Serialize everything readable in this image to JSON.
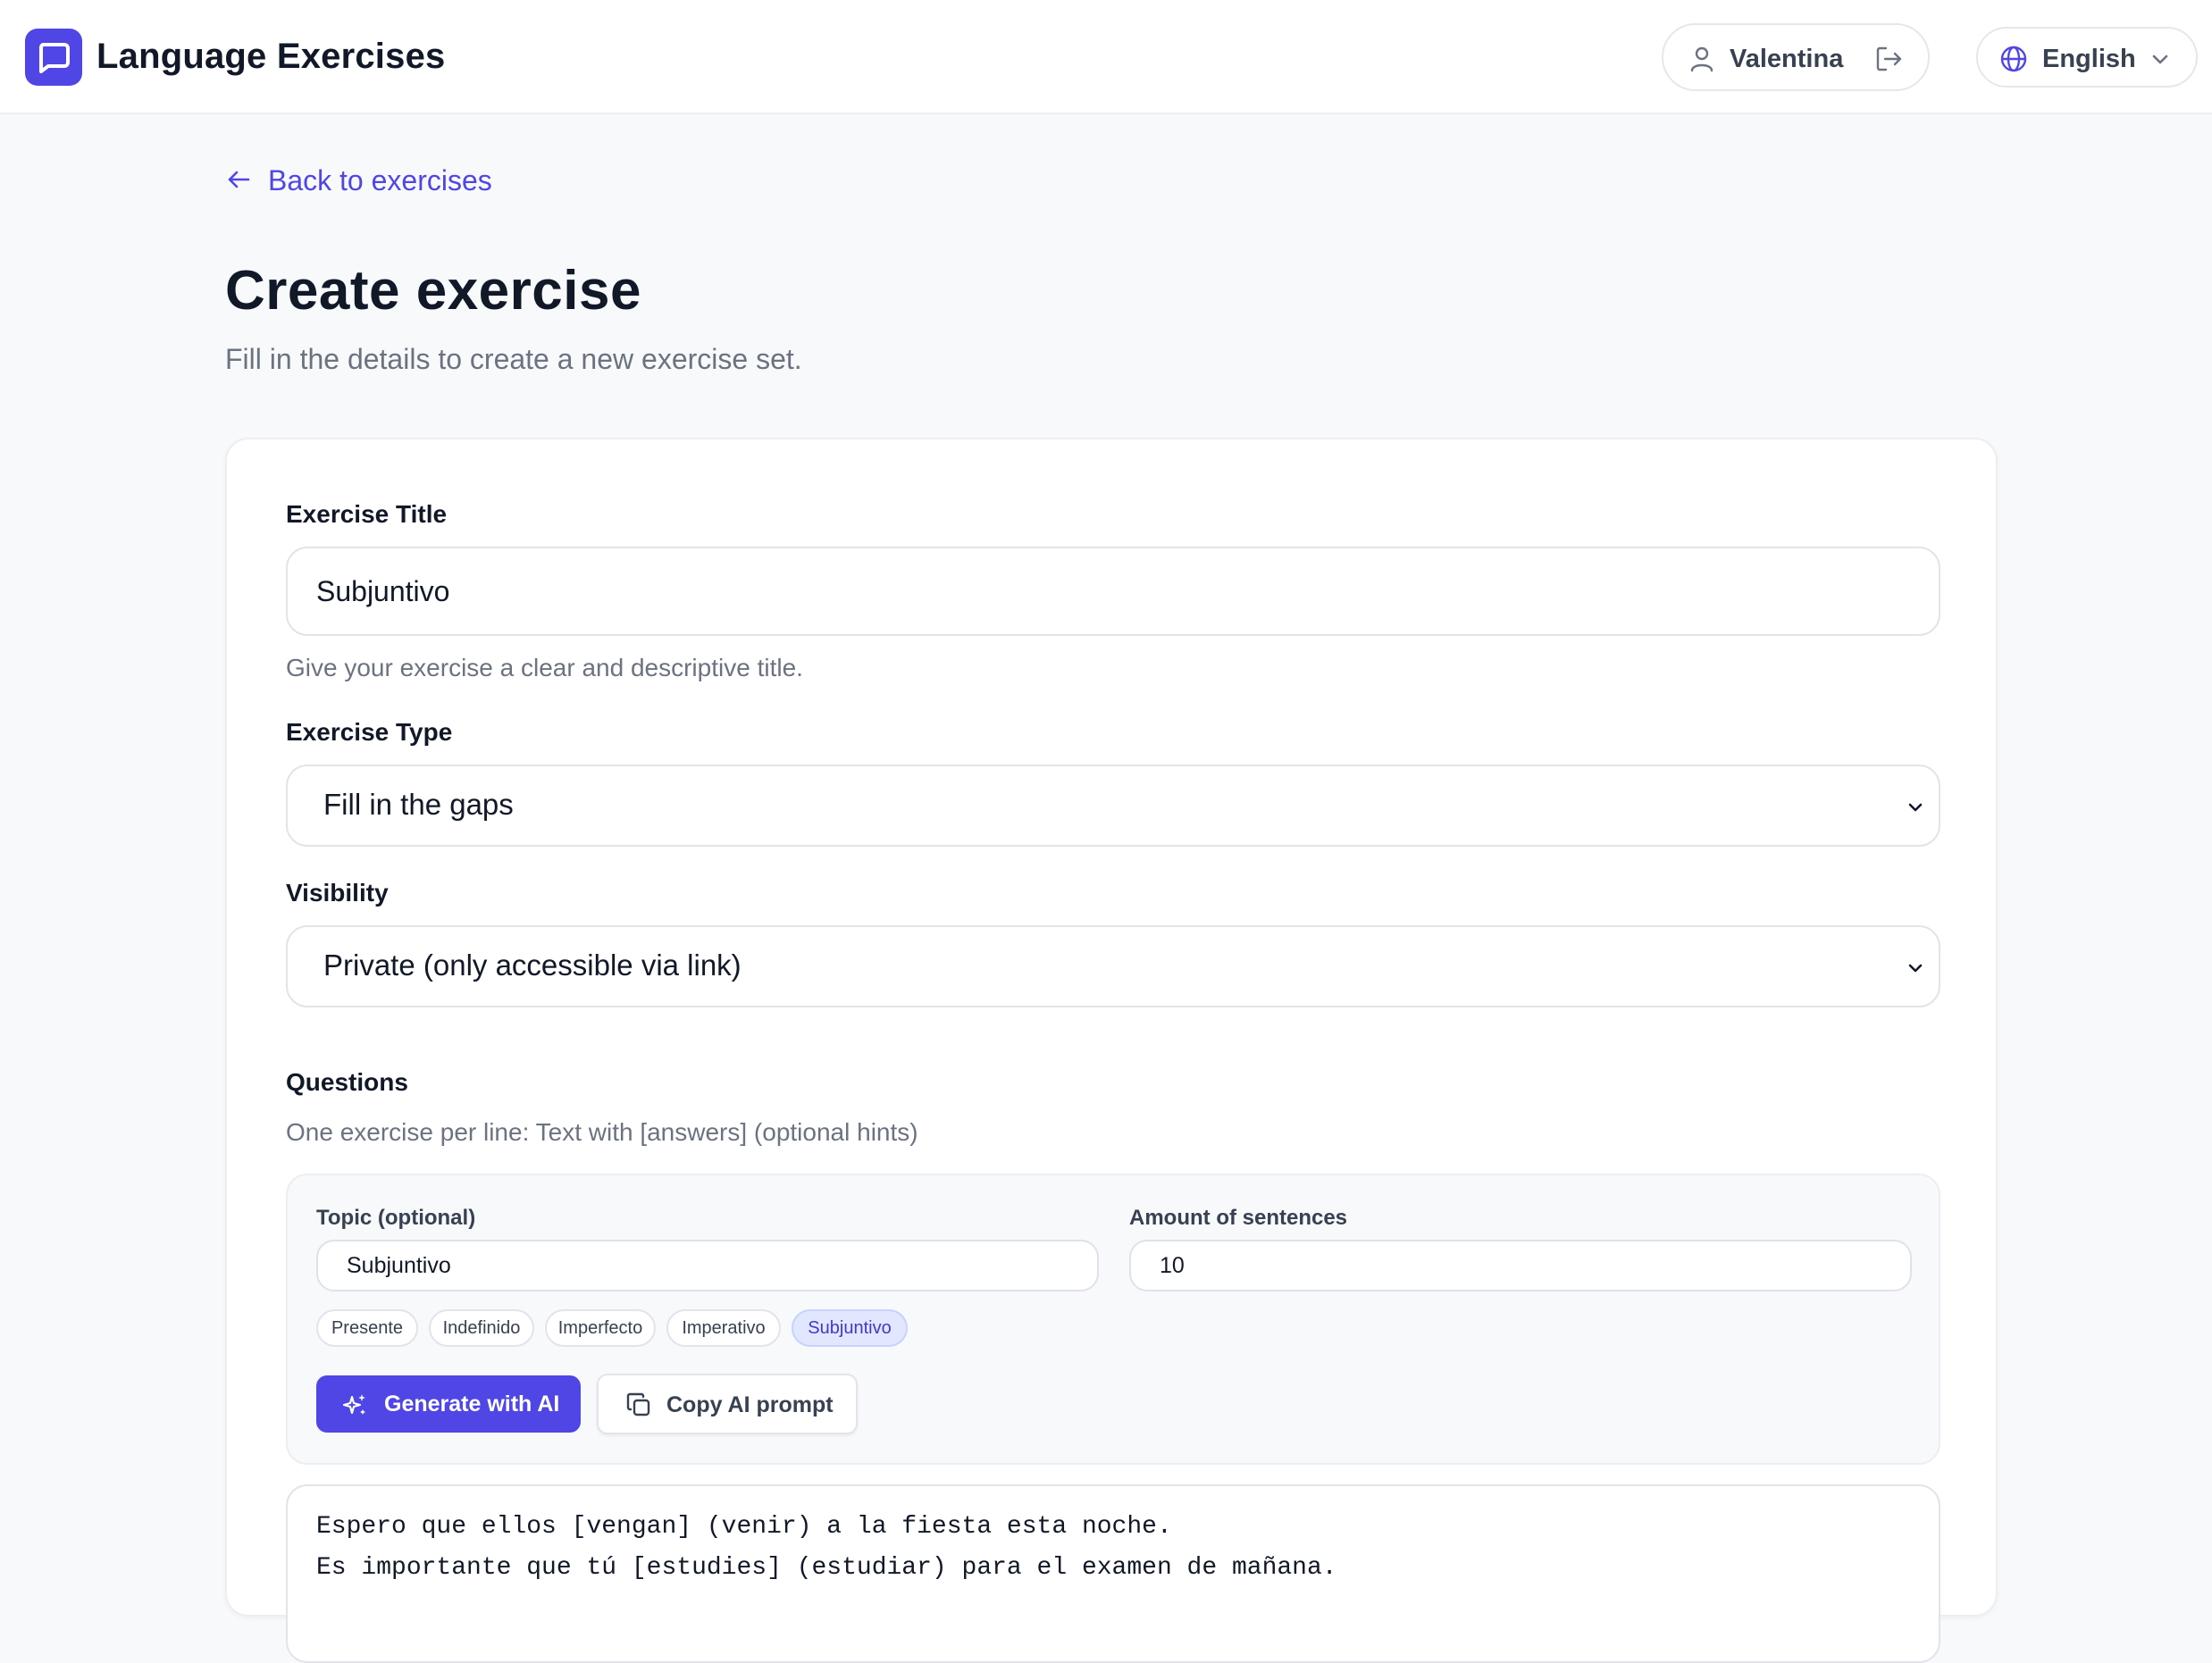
{
  "header": {
    "app_title": "Language Exercises",
    "user_name": "Valentina",
    "language": "English"
  },
  "nav": {
    "back_label": "Back to exercises"
  },
  "page": {
    "title": "Create exercise",
    "subtitle": "Fill in the details to create a new exercise set."
  },
  "form": {
    "title_label": "Exercise Title",
    "title_value": "Subjuntivo",
    "title_help": "Give your exercise a clear and descriptive title.",
    "type_label": "Exercise Type",
    "type_value": "Fill in the gaps",
    "visibility_label": "Visibility",
    "visibility_value": "Private (only accessible via link)",
    "questions_label": "Questions",
    "questions_help": "One exercise per line: Text with [answers] (optional hints)"
  },
  "ai_panel": {
    "topic_label": "Topic (optional)",
    "topic_value": "Subjuntivo",
    "amount_label": "Amount of sentences",
    "amount_value": "10",
    "chips": [
      "Presente",
      "Indefinido",
      "Imperfecto",
      "Imperativo",
      "Subjuntivo"
    ],
    "active_chip": "Subjuntivo",
    "generate_label": "Generate with AI",
    "copy_label": "Copy AI prompt"
  },
  "questions_text": [
    "Espero que ellos [vengan] (venir) a la fiesta esta noche.",
    "Es importante que tú [estudies] (estudiar) para el examen de mañana."
  ],
  "colors": {
    "accent": "#4f46e5",
    "chip_active_bg": "#e0e7ff",
    "muted_text": "#6b7280"
  }
}
